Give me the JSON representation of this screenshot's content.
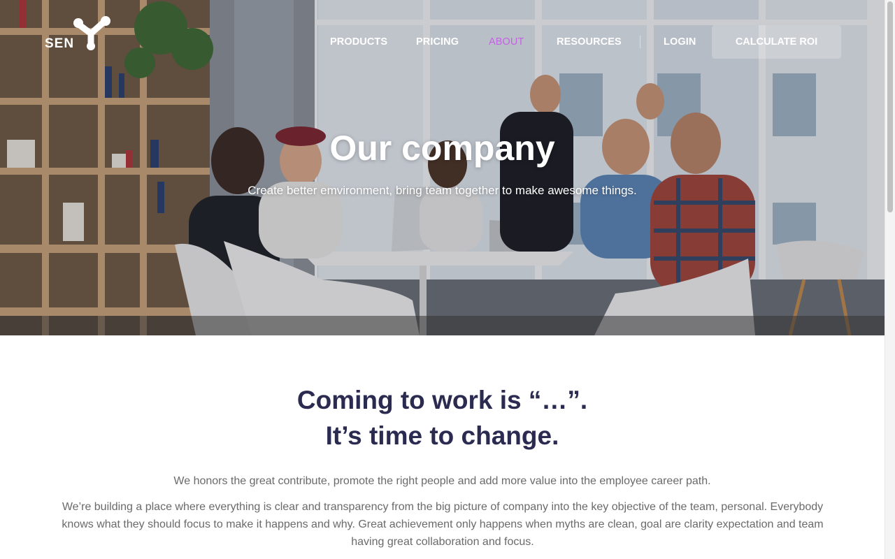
{
  "brand": {
    "logo_text": "SEN",
    "logo_icon": "y-molecule-logo-icon"
  },
  "nav": {
    "items": [
      {
        "label": "PRODUCTS"
      },
      {
        "label": "PRICING"
      },
      {
        "label": "ABOUT"
      },
      {
        "label": "RESOURCES"
      },
      {
        "label": "LOGIN"
      }
    ],
    "cta_label": "CALCULATE ROI",
    "active_item": "ABOUT"
  },
  "hero": {
    "title": "Our company",
    "subtitle": "Create better emvironment, bring team together to make awesome things."
  },
  "intro": {
    "headline_line1": "Coming to work is “…”.",
    "headline_line2": "It’s time to change.",
    "lead": "We honors the great contribute, promote the right people and add more value into the employee career path.",
    "body": "We’re building a place where everything is clear and transparency from the big picture of company into the key objective of the team, personal. Everybody knows what they should focus to make it happens and why. Great achievement only happens when myths are clean, goal are clarity expectation and team having great collaboration and focus."
  },
  "colors": {
    "nav_active": "#c462e4",
    "headline": "#2b2b52",
    "body_text": "#6a6a6a",
    "hero_text": "#ffffff"
  }
}
